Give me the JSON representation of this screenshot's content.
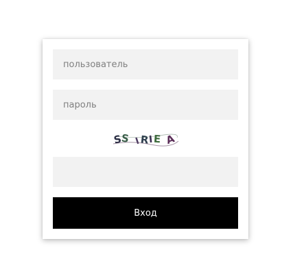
{
  "login_form": {
    "username_placeholder": "пользователь",
    "password_placeholder": "пароль",
    "captcha_input_placeholder": "",
    "captcha_code": "SSIRIEA",
    "submit_label": "Вход"
  },
  "colors": {
    "field_background": "#f2f2f2",
    "button_background": "#000000",
    "button_text": "#ffffff"
  }
}
